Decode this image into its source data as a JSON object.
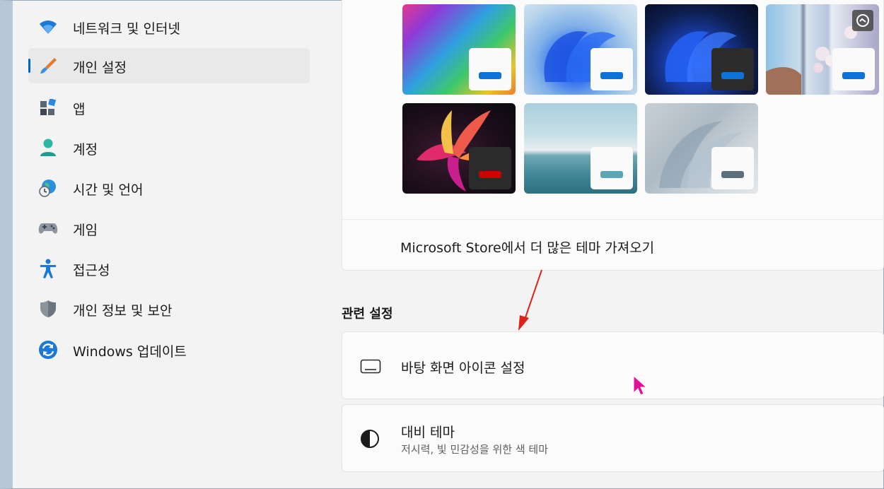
{
  "sidebar": {
    "items": [
      {
        "label": "네트워크 및 인터넷",
        "icon": "wifi-icon"
      },
      {
        "label": "개인 설정",
        "icon": "brush-icon",
        "selected": true
      },
      {
        "label": "앱",
        "icon": "apps-icon"
      },
      {
        "label": "계정",
        "icon": "person-icon"
      },
      {
        "label": "시간 및 언어",
        "icon": "globe-clock-icon"
      },
      {
        "label": "게임",
        "icon": "gamepad-icon"
      },
      {
        "label": "접근성",
        "icon": "accessibility-icon"
      },
      {
        "label": "개인 정보 및 보안",
        "icon": "shield-icon"
      },
      {
        "label": "Windows 업데이트",
        "icon": "update-icon"
      }
    ]
  },
  "themes": {
    "store_link": "Microsoft Store에서 더 많은 테마 가져오기",
    "tiles": [
      {
        "name": "rainbow",
        "accent": "#0a72d8",
        "badge": "light"
      },
      {
        "name": "windows-light",
        "accent": "#0a72d8",
        "badge": "light"
      },
      {
        "name": "windows-dark",
        "accent": "#0a72d8",
        "badge": "dark"
      },
      {
        "name": "blossom",
        "accent": "#0a72d8",
        "badge": "light"
      },
      {
        "name": "glow",
        "accent": "#cc0000",
        "badge": "dark"
      },
      {
        "name": "lake",
        "accent": "#5aa6b4",
        "badge": "light"
      },
      {
        "name": "flow",
        "accent": "#5b6f7d",
        "badge": "light"
      }
    ]
  },
  "related": {
    "title": "관련 설정",
    "desktop_icons": {
      "title": "바탕 화면 아이콘 설정",
      "icon": "monitor-icon"
    },
    "contrast": {
      "title": "대비 테마",
      "subtitle": "저시력, 빛 민감성을 위한 색 테마",
      "icon": "contrast-icon"
    }
  },
  "colors": {
    "accent": "#0067c0",
    "annotation_arrow": "#e0201a",
    "cursor": "#e0109a"
  }
}
